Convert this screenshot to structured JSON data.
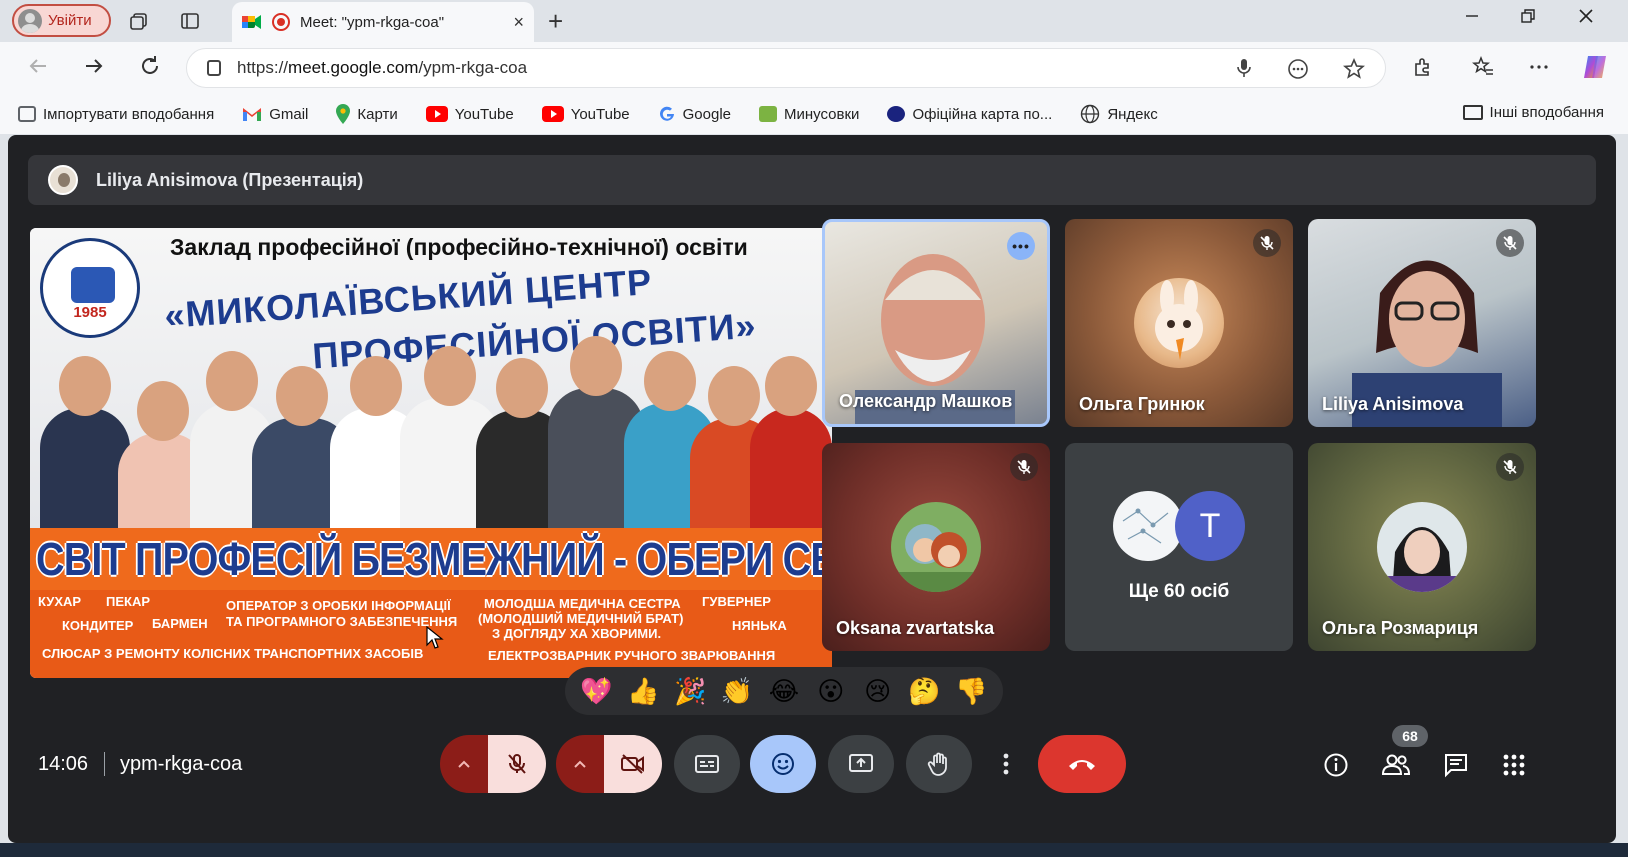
{
  "browser": {
    "profile_label": "Увійти",
    "tab_title": "Meet: \"ypm-rkga-coa\"",
    "url_prefix": "https://",
    "url_host": "meet.google.com",
    "url_path": "/ypm-rkga-coa",
    "new_tab_glyph": "+",
    "tab_close_glyph": "×",
    "bookmarks": [
      {
        "label": "Імпортувати вподобання",
        "icon": "import-icon",
        "color": "#5f6368"
      },
      {
        "label": "Gmail",
        "icon": "gmail-icon",
        "color": "#ea4335"
      },
      {
        "label": "Карти",
        "icon": "maps-icon",
        "color": "#34a853"
      },
      {
        "label": "YouTube",
        "icon": "youtube-icon",
        "color": "#ff0000"
      },
      {
        "label": "YouTube",
        "icon": "youtube-icon",
        "color": "#ff0000"
      },
      {
        "label": "Google",
        "icon": "google-icon",
        "color": "#4285f4"
      },
      {
        "label": "Минусовки",
        "icon": "music-icon",
        "color": "#7cb342"
      },
      {
        "label": "Офіційна карта по...",
        "icon": "map-badge-icon",
        "color": "#1a237e"
      },
      {
        "label": "Яндекс",
        "icon": "globe-icon",
        "color": "#333333"
      }
    ],
    "other_bookmarks": "Інші вподобання"
  },
  "meet": {
    "presenter_label": "Liliya Anisimova (Презентація)",
    "slide": {
      "heading": "Заклад професійної (професійно-технічної) освіти",
      "line1": "«МИКОЛАЇВСЬКИЙ ЦЕНТР",
      "line2": "ПРОФЕСІЙНОЇ ОСВІТИ»",
      "logo_year": "1985",
      "slogan": "СВІТ ПРОФЕСІЙ БЕЗМЕЖНИЙ - ОБЕРИ СВОЮ!",
      "jobs": {
        "j1": "КУХАР",
        "j2": "ПЕКАР",
        "j3": "КОНДИТЕР",
        "j4": "БАРМЕН",
        "j5": "ОПЕРАТОР З ОРОБКИ ІНФОРМАЦІЇ",
        "j6": "ТА ПРОГРАМНОГО ЗАБЕЗПЕЧЕННЯ",
        "j7": "МОЛОДША МЕДИЧНА СЕСТРА",
        "j8": "(МОЛОДШИЙ МЕДИЧНИЙ БРАТ)",
        "j9": "З ДОГЛЯДУ ХА ХВОРИМИ.",
        "j10": "ГУВЕРНЕР",
        "j11": "НЯНЬКА",
        "j12": "СЛЮСАР З РЕМОНТУ КОЛІСНИХ ТРАНСПОРТНИХ ЗАСОБІВ",
        "j13": "ЕЛЕКТРОЗВАРНИК РУЧНОГО ЗВАРЮВАННЯ"
      }
    },
    "participants": {
      "p1": "Олександр Машков",
      "p2": "Ольга Гринюк",
      "p3": "Liliya Anisimova",
      "p4": "Oksana zvartatska",
      "others_label": "Ще 60 осіб",
      "others_initial": "T",
      "p6": "Ольга Розмариця"
    },
    "more_dots": "•••",
    "reactions": [
      "💖",
      "👍",
      "🎉",
      "👏",
      "😂",
      "😮",
      "😢",
      "🤔",
      "👎"
    ],
    "clock": "14:06",
    "meeting_code": "ypm-rkga-coa",
    "people_count": "68",
    "colors": {
      "end_call": "#dc362e",
      "active_control": "#a8c7fa",
      "muted_red": "#f9dedc"
    }
  }
}
